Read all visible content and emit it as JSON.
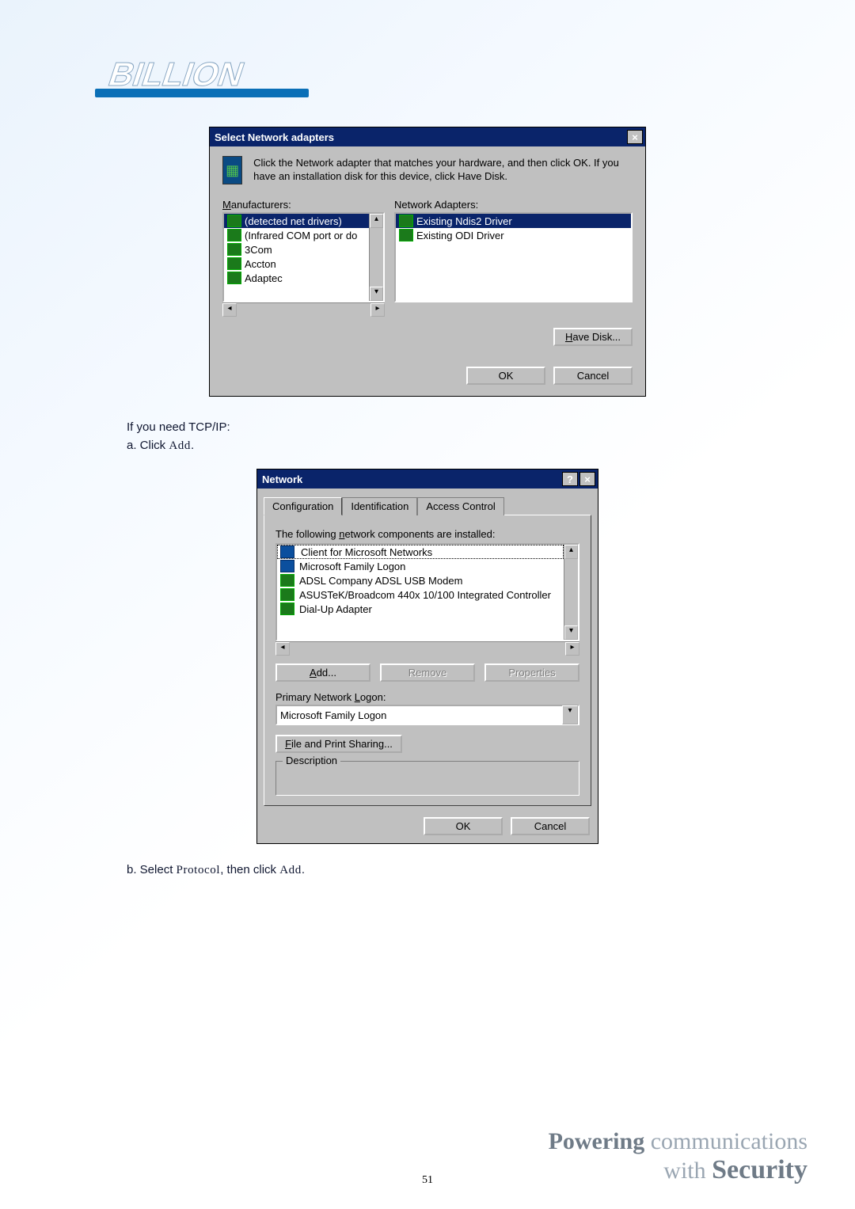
{
  "brand": "BILLION",
  "dialog1": {
    "title": "Select Network adapters",
    "close": "×",
    "instruction": "Click the Network adapter that matches your hardware, and then click OK. If you have an installation disk for this device, click Have Disk.",
    "manufacturers_label": "Manufacturers:",
    "adapters_label": "Network Adapters:",
    "manufacturers": [
      "(detected net drivers)",
      "(Infrared COM port or do",
      "3Com",
      "Accton",
      "Adaptec"
    ],
    "adapters": [
      "Existing Ndis2 Driver",
      "Existing ODI Driver"
    ],
    "have_disk": "Have Disk...",
    "ok": "OK",
    "cancel": "Cancel"
  },
  "text1": "If you need TCP/IP:",
  "text2a": "a. Click ",
  "text2b": "Add",
  "text2c": ".",
  "dialog2": {
    "title": "Network",
    "help": "?",
    "close": "×",
    "tabs": [
      "Configuration",
      "Identification",
      "Access Control"
    ],
    "list_label": "The following network components are installed:",
    "components": [
      "Client for Microsoft Networks",
      "Microsoft Family Logon",
      "ADSL Company ADSL USB Modem",
      "ASUSTeK/Broadcom 440x 10/100 Integrated Controller",
      "Dial-Up Adapter"
    ],
    "add": "Add...",
    "remove": "Remove",
    "properties": "Properties",
    "primary_label": "Primary Network Logon:",
    "primary_value": "Microsoft Family Logon",
    "fps": "File and Print Sharing...",
    "desc_label": "Description",
    "ok": "OK",
    "cancel": "Cancel"
  },
  "text3a": "b. Select ",
  "text3b": "Protocol",
  "text3c": ", then click ",
  "text3d": "Add",
  "text3e": ".",
  "page_number": "51",
  "slogan": {
    "l1a": "Powering",
    "l1b": "communications",
    "l2a": "with",
    "l2b": "Security"
  }
}
